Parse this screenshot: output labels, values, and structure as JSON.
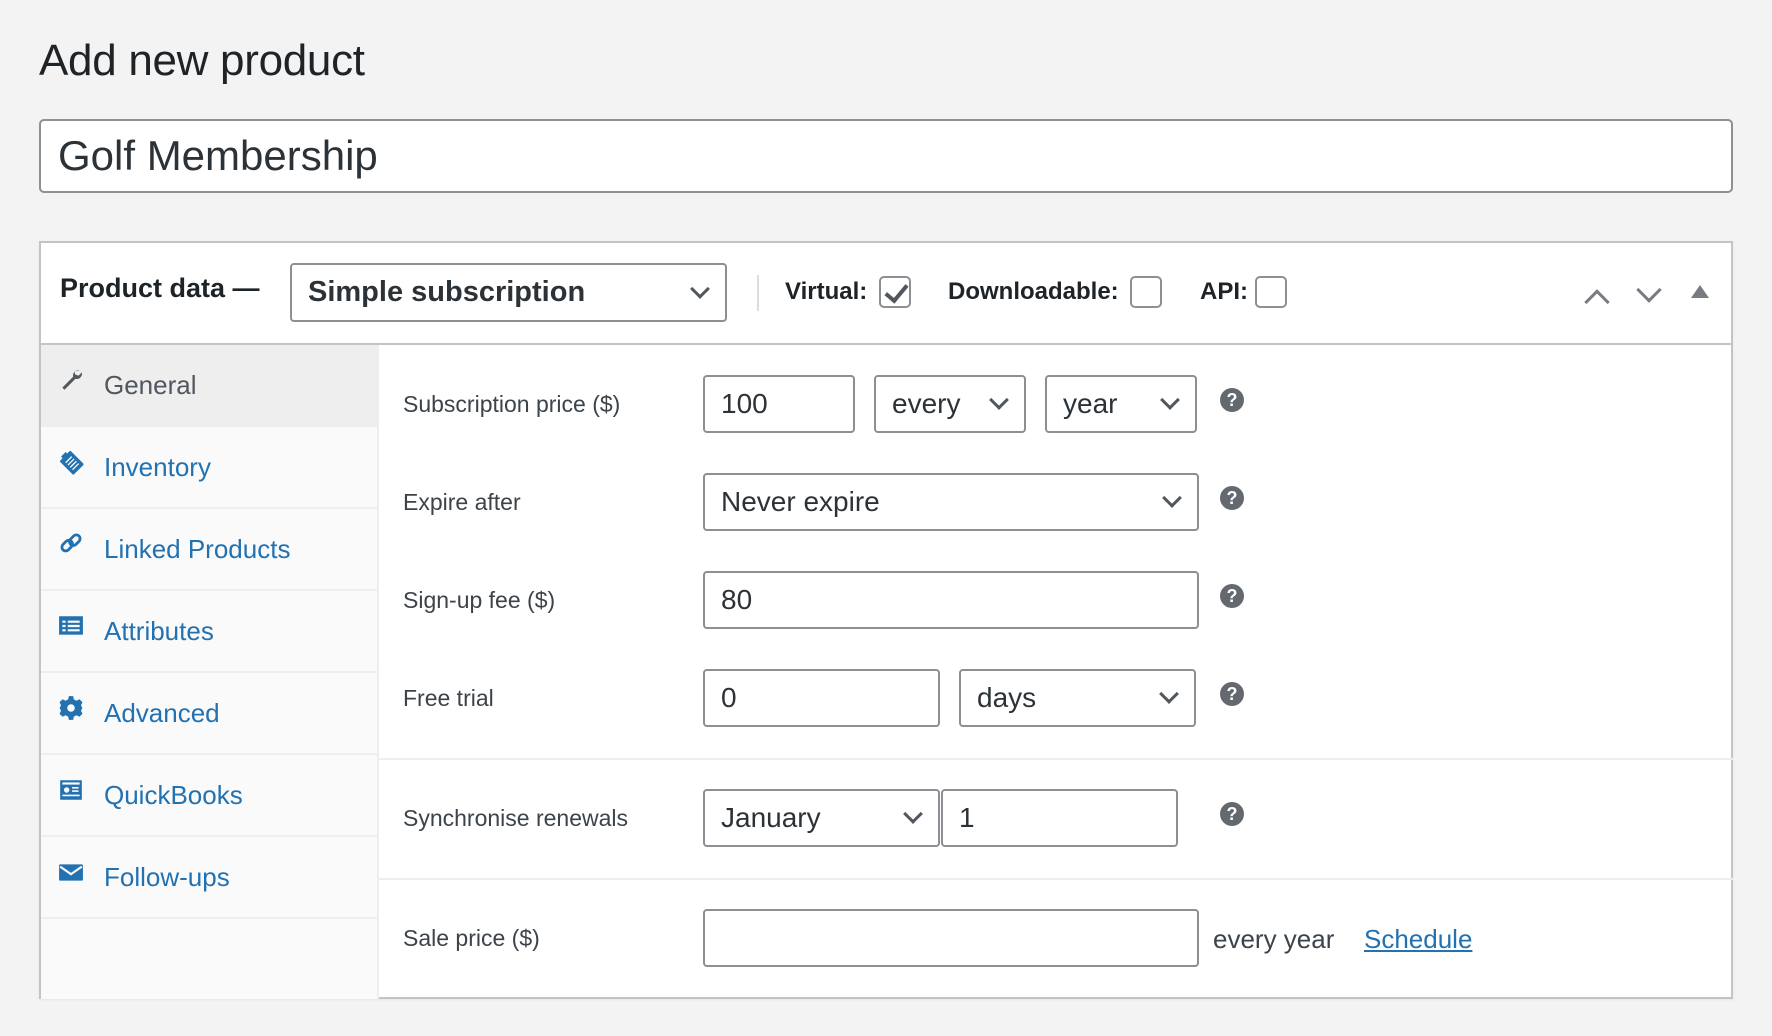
{
  "page": {
    "title": "Add new product",
    "product_name": "Golf Membership"
  },
  "product_data": {
    "label": "Product data —",
    "type_select": "Simple subscription",
    "virtual_label": "Virtual:",
    "virtual_checked": true,
    "downloadable_label": "Downloadable:",
    "downloadable_checked": false,
    "api_label": "API:",
    "api_checked": false
  },
  "tabs": [
    {
      "label": "General",
      "icon": "wrench-icon",
      "active": true
    },
    {
      "label": "Inventory",
      "icon": "clipboard-icon",
      "active": false
    },
    {
      "label": "Linked Products",
      "icon": "link-icon",
      "active": false
    },
    {
      "label": "Attributes",
      "icon": "list-table-icon",
      "active": false
    },
    {
      "label": "Advanced",
      "icon": "gear-icon",
      "active": false
    },
    {
      "label": "QuickBooks",
      "icon": "id-card-icon",
      "active": false
    },
    {
      "label": "Follow-ups",
      "icon": "envelope-icon",
      "active": false
    }
  ],
  "fields": {
    "subscription_price": {
      "label": "Subscription price ($)",
      "value": "100",
      "interval": "every",
      "period": "year"
    },
    "expire_after": {
      "label": "Expire after",
      "value": "Never expire"
    },
    "signup_fee": {
      "label": "Sign-up fee ($)",
      "value": "80"
    },
    "free_trial": {
      "label": "Free trial",
      "value": "0",
      "period": "days"
    },
    "sync_renewals": {
      "label": "Synchronise renewals",
      "month": "January",
      "day": "1"
    },
    "sale_price": {
      "label": "Sale price ($)",
      "value": "",
      "suffix": "every year",
      "schedule_link": "Schedule"
    }
  },
  "help_glyph": "?",
  "colors": {
    "link": "#2271b1",
    "border": "#8c8f94",
    "background": "#f3f3f3"
  }
}
